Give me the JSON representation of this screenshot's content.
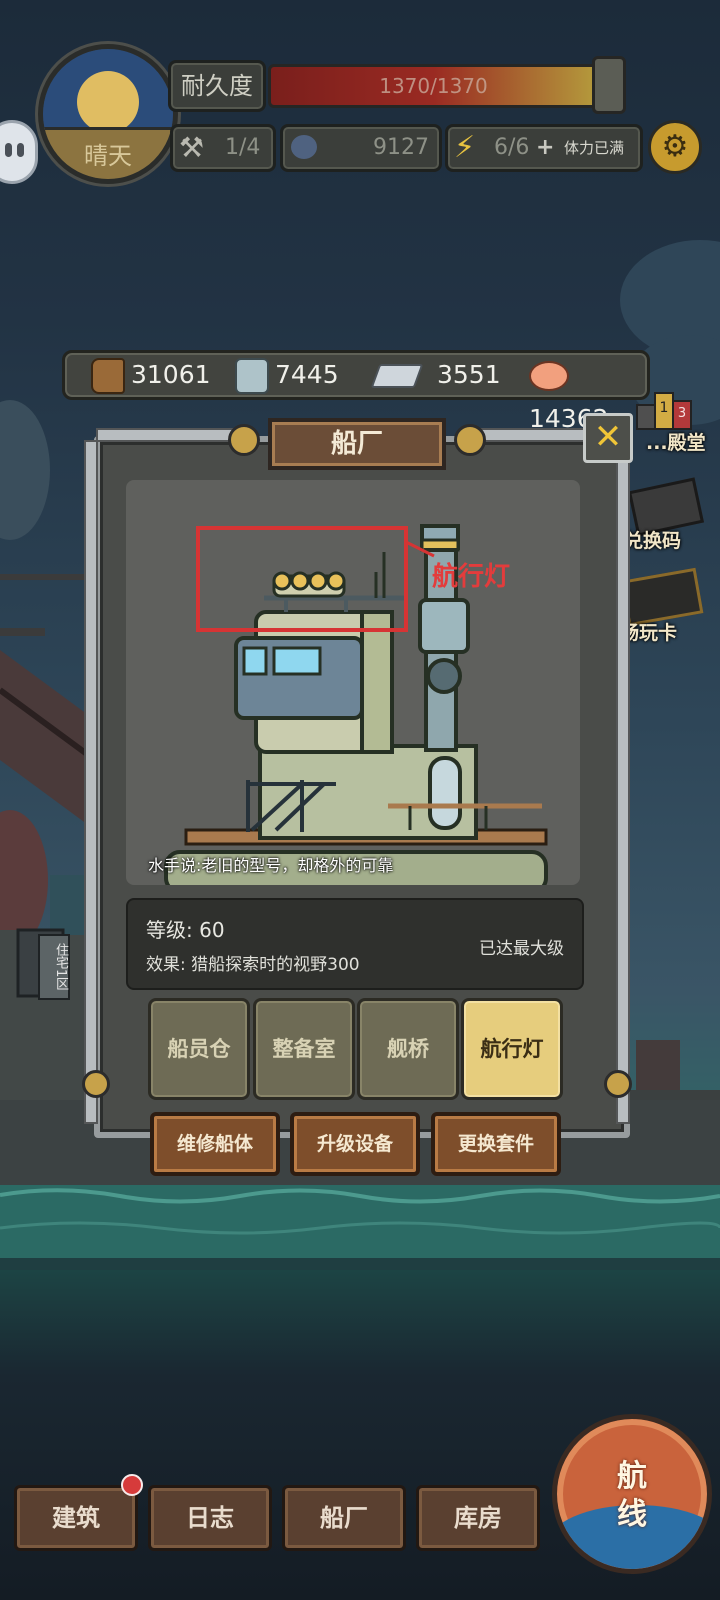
{
  "hud": {
    "weather": "晴天",
    "durability_label": "耐久度",
    "durability_value": "1370/1370",
    "durability_fraction": 1.0,
    "tools": "1/4",
    "coins": "9127",
    "stamina": "6/6",
    "stamina_plus": "+",
    "stamina_status": "体力已满"
  },
  "resources": [
    {
      "icon": "wood-log-icon",
      "value": "31061"
    },
    {
      "icon": "lumber-icon",
      "value": "7445"
    },
    {
      "icon": "iron-ingot-icon",
      "value": "3551"
    },
    {
      "icon": "fish-meat-icon",
      "value": "14362"
    }
  ],
  "side_menu": {
    "hall": "...殿堂",
    "hall_ranks": [
      "1",
      "3"
    ],
    "redeem": "兑换码",
    "pass": "畅玩卡"
  },
  "panel": {
    "title": "船厂",
    "close": "✕",
    "caption": "水手说:老旧的型号，却格外的可靠",
    "highlight_label": "航行灯",
    "level": "等级: 60",
    "effect": "效果: 猎船探索时的视野300",
    "max": "已达最大级",
    "tabs": [
      "船员仓",
      "整备室",
      "舰桥",
      "航行灯"
    ],
    "active_tab": 3,
    "actions": [
      "维修船体",
      "升级设备",
      "更换套件"
    ]
  },
  "background_signs": {
    "residence": "住宅1区"
  },
  "nav": {
    "items": [
      "建筑",
      "日志",
      "船厂",
      "库房"
    ],
    "route": "航线"
  },
  "colors": {
    "accent_gold": "#e6cd7d",
    "highlight_red": "#d63434",
    "button_brown": "#7e4e2b"
  }
}
